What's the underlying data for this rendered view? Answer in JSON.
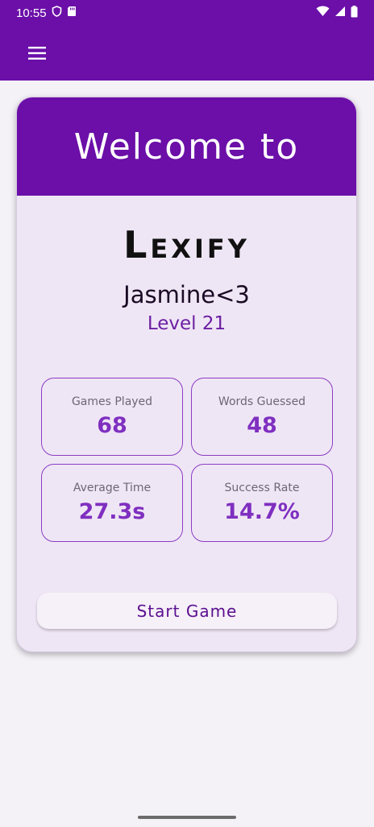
{
  "status_bar": {
    "time": "10:55",
    "left_icons": [
      "shield-icon",
      "sd-card-icon"
    ],
    "right_icons": [
      "wifi-icon",
      "signal-icon",
      "battery-icon"
    ]
  },
  "app_bar": {
    "menu_icon": "hamburger-menu-icon"
  },
  "card": {
    "welcome": "Welcome to",
    "brand": "Lexify",
    "username": "Jasmine<3",
    "level": "Level 21",
    "stats": [
      {
        "label": "Games Played",
        "value": "68"
      },
      {
        "label": "Words Guessed",
        "value": "48"
      },
      {
        "label": "Average Time",
        "value": "27.3s"
      },
      {
        "label": "Success Rate",
        "value": "14.7%"
      }
    ],
    "start_button": "Start Game"
  },
  "colors": {
    "primary": "#6b0fa8",
    "card_background": "#efe6f5",
    "stat_value": "#7f2fc0",
    "page_background": "#f4f1f7"
  }
}
